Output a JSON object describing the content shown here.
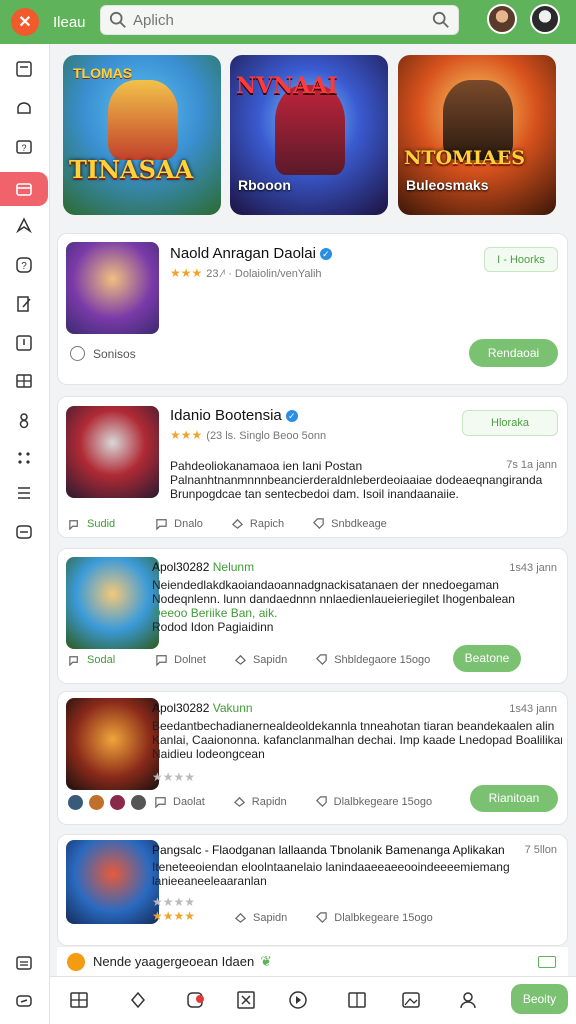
{
  "header": {
    "app_name": "Ileau",
    "search_placeholder": "Aplich",
    "brand_color": "#5fb35a"
  },
  "sidebar": {
    "items": [
      "doc-icon",
      "chat-icon",
      "help-card-icon",
      "store-icon",
      "bookmark-icon",
      "question-icon",
      "edit-icon",
      "alert-icon",
      "grid-icon",
      "group-icon",
      "dots-icon",
      "list-icon",
      "message-icon"
    ],
    "bottom_items": [
      "stack-icon",
      "exit-icon"
    ]
  },
  "featured": [
    {
      "top": "TLOMAS",
      "big": "TINASAA",
      "subtitle": ""
    },
    {
      "top": "",
      "big": "NVNAAI",
      "subtitle": "Rbooon"
    },
    {
      "top": "",
      "big": "NTOMIAES",
      "subtitle": "Buleosmaks"
    }
  ],
  "cards": [
    {
      "title": "Naold Anragan Daolai",
      "stars": "★★★",
      "meta": "23 ⁄ᶦ · Dolaiolin/venYalih",
      "badge": "I - Hoorks",
      "radio_label": "Sonisos",
      "button": "Rendaoai"
    },
    {
      "title": "Idanio Bootensia",
      "stars": "★★★",
      "meta": "(23 ls. Singlo Beoo 5onn",
      "badge": "Hloraka",
      "time": "7s 1a jann",
      "desc_lines": [
        "Pahdeoliokanamaoa ien Iani Postan",
        "Palnanhtnanmnnnbeancierderaldnleberdeoiaaiae dodeaeqnangiranda",
        "Brunpogdcae tan sentecbedoi dam. Isoil inandaanaiie."
      ],
      "tag": "Sudid",
      "actions": [
        "Dnalo",
        "Rapich",
        "Snbdkeage"
      ]
    },
    {
      "title": "Apol30282",
      "title_tag": "Nelunm",
      "time": "1s43 jann",
      "desc_lines": [
        "Neiendedlakdkaoiandaoannadgnackisatanaen der nnedoegaman",
        "Nodeqnlenn. lunn dandaednnn nnlaedienlaueieriegilet Ihogenbalean",
        "Deeoo Beriike Ban, aik.",
        "Rodod Idon Pagiaidinn"
      ],
      "tag": "Sodal",
      "actions": [
        "Dolnet",
        "Sapidn",
        "Shbldegaore 15ogo"
      ],
      "button": "Beatone"
    },
    {
      "title": "Apol30282",
      "title_tag": "Vakunn",
      "time": "1s43 jann",
      "desc_lines": [
        "Beedantbechadianernealdeoldekannla tnneahotan tiaran beandekaalen alin",
        "Kanlai, Caaiononna. kafanclanmalhan dechai. Imp kaade Lnedopad Boalilikanan",
        "Naidieu lodeongcean"
      ],
      "stars": "★★★★",
      "actions": [
        "Daolat",
        "Rapidn",
        "Dlalbkegeare 15ogo"
      ],
      "button": "Rianitoan"
    },
    {
      "title": "Pangsalc - Flaodganan lallaanda Tbnolanik Bamenanga Aplikakan",
      "time": "7 5llon",
      "desc_lines": [
        "Iteneteeoiendan eloolntaanelaio lanindaaeeaeeooindeeeemiemang",
        "lanieeaneeleaaranlan"
      ],
      "stars": "★★★★",
      "actions": [
        "Sapidn",
        "Dlalbkegeare 15ogo"
      ]
    }
  ],
  "notification": {
    "text": "Nende yaagergeoean Idaen"
  },
  "bottom": {
    "button": "Beoity"
  }
}
